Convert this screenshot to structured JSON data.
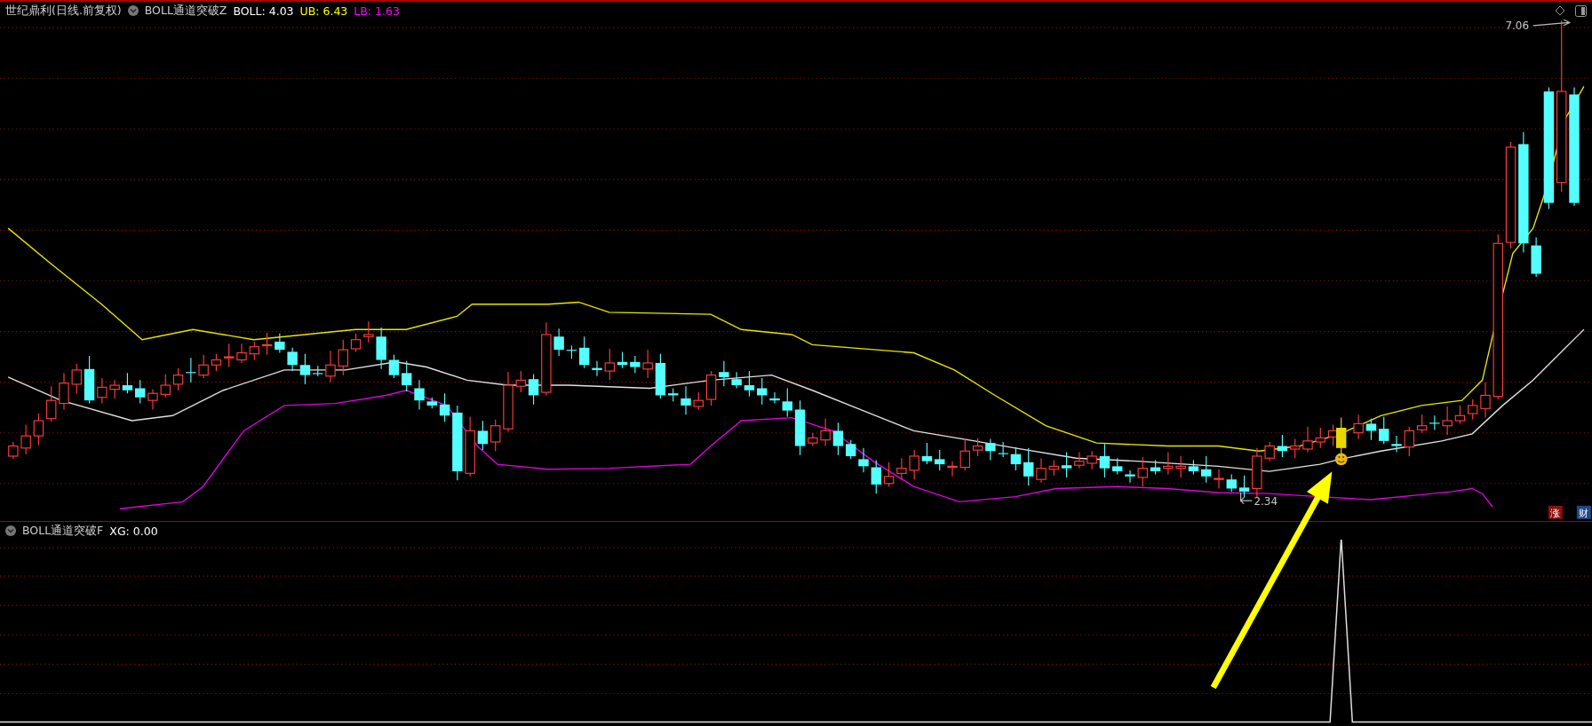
{
  "main_panel": {
    "stock_name": "世纪鼎利(日线.前复权)",
    "indicator": {
      "name": "BOLL通道突破Z",
      "values": [
        {
          "label": "BOLL: 4.03",
          "color": "#ffffff"
        },
        {
          "label": "UB: 6.43",
          "color": "#ffff00"
        },
        {
          "label": "LB: 1.63",
          "color": "#ff00ff"
        }
      ]
    },
    "price_labels": [
      {
        "kind": "high",
        "text": "7.06"
      },
      {
        "kind": "low",
        "text": "2.34"
      }
    ],
    "badges": [
      {
        "text": "涨",
        "color": "#8b1010"
      },
      {
        "text": "财",
        "color": "#1d4a8a"
      }
    ]
  },
  "sub_panel": {
    "indicator": {
      "name": "BOLL通道突破F",
      "values": [
        {
          "label": "XG: 0.00",
          "color": "#ffffff"
        }
      ]
    }
  }
}
